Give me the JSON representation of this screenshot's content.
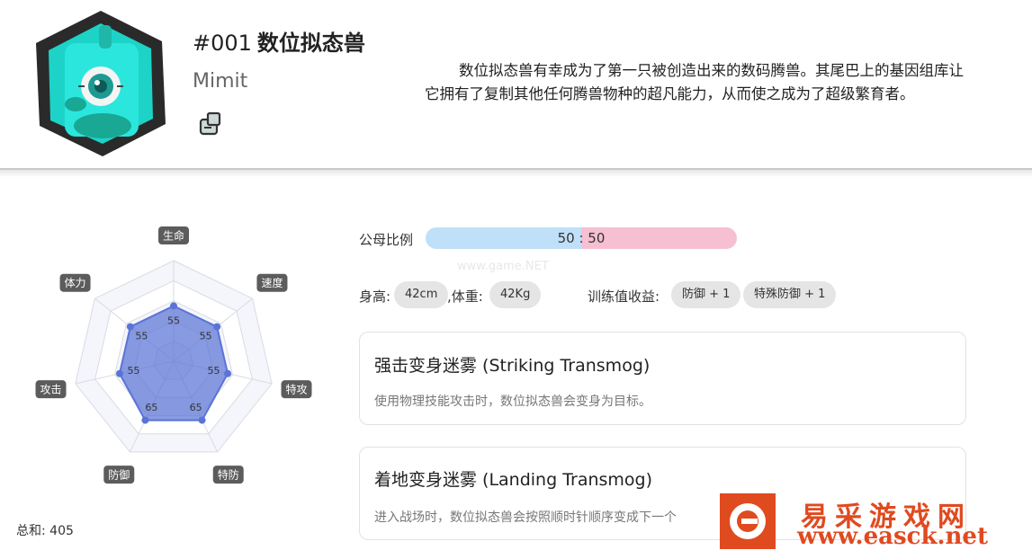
{
  "pokemon": {
    "number": "#001",
    "name": "数位拟态兽",
    "english_name": "Mimit",
    "type_icon": "cube-type-icon",
    "description_line1": "数位拟态兽有幸成为了第一只被创造出来的数码腾兽。其尾巴上的基因组库让",
    "description_line2": "它拥有了复制其他任何腾兽物种的超凡能力，从而使之成为了超级繁育者。"
  },
  "stats": {
    "labels": [
      "生命",
      "速度",
      "特攻",
      "特防",
      "防御",
      "攻击",
      "体力"
    ],
    "values": [
      55,
      55,
      55,
      65,
      65,
      55,
      55
    ],
    "total_label": "总和: 405"
  },
  "chart_data": {
    "type": "radar",
    "categories": [
      "生命",
      "速度",
      "特攻",
      "特防",
      "防御",
      "攻击",
      "体力"
    ],
    "values": [
      55,
      55,
      55,
      65,
      65,
      55,
      55
    ],
    "color": "#5a73d6"
  },
  "gender": {
    "label": "公母比例",
    "ratio_text": "50 : 50",
    "male_fraction": 0.5,
    "male_color": "#bfe0f8",
    "female_color": "#f6bfd2"
  },
  "body": {
    "height_label": "身高:",
    "height": "42cm",
    "weight_label": ",体重:",
    "weight": "42Kg",
    "ev_label": "训练值收益:",
    "ev_items": [
      "防御 + 1",
      "特殊防御 + 1"
    ]
  },
  "abilities": [
    {
      "title": "强击变身迷雾 (Striking Transmog)",
      "desc": "使用物理技能攻击时，数位拟态兽会变身为目标。"
    },
    {
      "title": "着地变身迷雾 (Landing Transmog)",
      "desc": "进入战场时，数位拟态兽会按照顺时针顺序变成下一个"
    }
  ],
  "watermark": {
    "faint": "www.game.NET",
    "title": "易采游戏网",
    "url": "www.easck.net"
  }
}
